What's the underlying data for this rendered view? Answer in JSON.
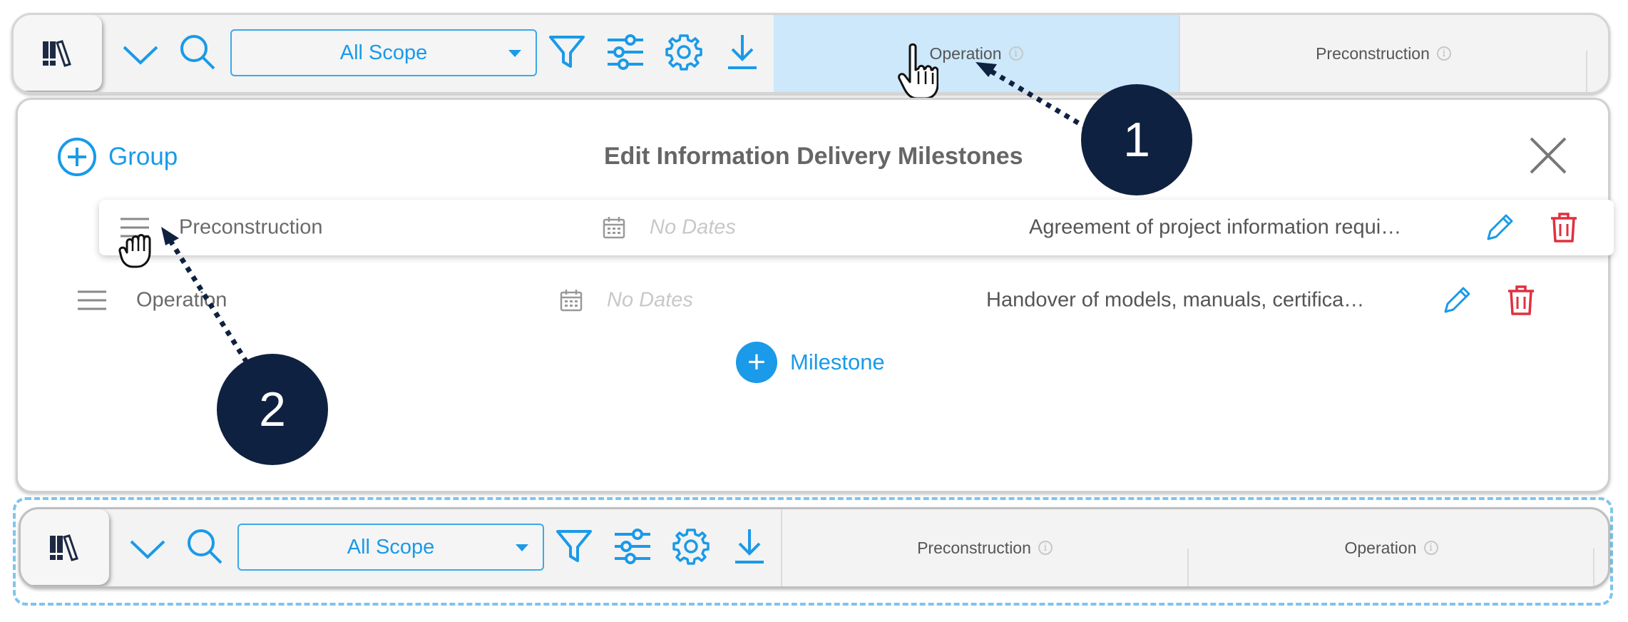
{
  "top_toolbar": {
    "scope_label": "All Scope",
    "columns": [
      {
        "label": "Operation",
        "highlighted": true
      },
      {
        "label": "Preconstruction",
        "highlighted": false
      }
    ]
  },
  "panel": {
    "group_button_label": "Group",
    "title": "Edit Information Delivery Milestones",
    "rows": [
      {
        "name": "Preconstruction",
        "dates": "No Dates",
        "description": "Agreement of project information requi…"
      },
      {
        "name": "Operation",
        "dates": "No Dates",
        "description": "Handover of models, manuals, certifica…"
      }
    ],
    "milestone_button_label": "Milestone"
  },
  "bottom_toolbar": {
    "scope_label": "All Scope",
    "columns": [
      {
        "label": "Preconstruction"
      },
      {
        "label": "Operation"
      }
    ]
  },
  "callouts": {
    "first": "1",
    "second": "2"
  },
  "colors": {
    "accent_blue": "#1a9ae8",
    "highlight_column": "#cce8fa",
    "delete_red": "#e0303e",
    "callout_navy": "#0f2140",
    "dashed_frame": "#7fc4ec"
  },
  "icons": [
    "library-icon",
    "chevron-down-icon",
    "search-icon",
    "filter-icon",
    "sliders-icon",
    "gear-icon",
    "download-icon",
    "info-icon",
    "close-icon",
    "drag-handle-icon",
    "calendar-icon",
    "pencil-icon",
    "trash-icon",
    "plus-circle-icon",
    "hand-pointer-icon",
    "hand-grab-icon"
  ]
}
